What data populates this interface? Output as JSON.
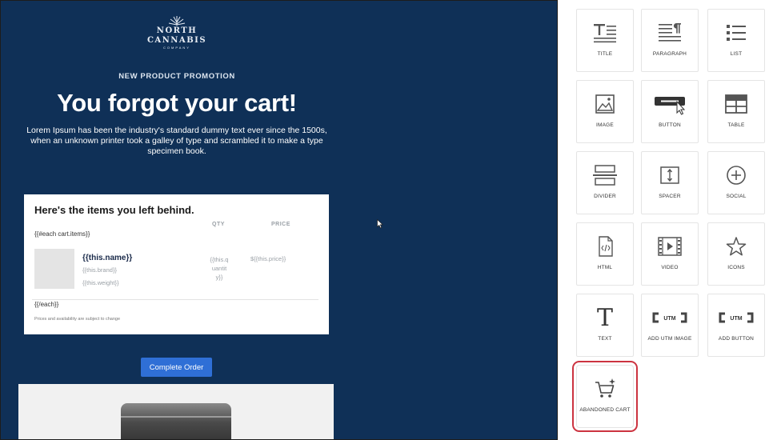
{
  "email": {
    "logo": {
      "brand": "NORTH CANNABIS",
      "sub": "COMPANY"
    },
    "promo_label": "NEW PRODUCT PROMOTION",
    "headline": "You forgot your cart!",
    "intro": "Lorem Ipsum has been the industry's standard dummy text ever since the 1500s, when an unknown printer took a galley of type and scrambled it to make a type specimen book.",
    "cart": {
      "heading": "Here's the items you left behind.",
      "qty_header": "QTY",
      "price_header": "PRICE",
      "each_open": "{{#each cart.items}}",
      "product_name": "{{this.name}}",
      "product_brand": "{{this.brand}}",
      "product_weight": "{{this.weight}}",
      "qty_value": "{{this.quantity}}",
      "price_value": "${{this.price}}",
      "each_close": "{{/each}}",
      "disclaimer": "Prices and availability are subject to change"
    },
    "button_label": "Complete Order"
  },
  "blocks": {
    "title": "TITLE",
    "paragraph": "PARAGRAPH",
    "list": "LIST",
    "image": "IMAGE",
    "button": "BUTTON",
    "table": "TABLE",
    "divider": "DIVIDER",
    "spacer": "SPACER",
    "social": "SOCIAL",
    "html": "HTML",
    "video": "VIDEO",
    "icons": "ICONS",
    "text": "TEXT",
    "text_glyph": "T",
    "add_utm_image": "ADD UTM IMAGE",
    "add_button": "ADD BUTTON",
    "utm_badge": "UTM",
    "abandoned_cart": "ABANDONED CART"
  },
  "colors": {
    "canvas_bg": "#0f3057",
    "button_bg": "#2f6fd6",
    "highlight": "#cc3340"
  }
}
